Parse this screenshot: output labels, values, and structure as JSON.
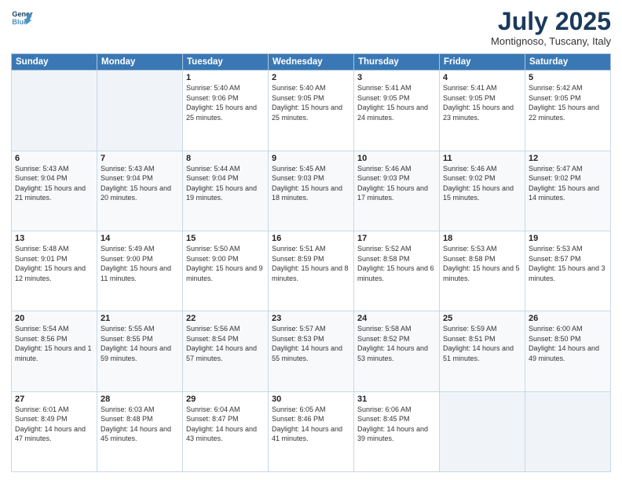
{
  "logo": {
    "line1": "General",
    "line2": "Blue"
  },
  "title": "July 2025",
  "subtitle": "Montignoso, Tuscany, Italy",
  "weekdays": [
    "Sunday",
    "Monday",
    "Tuesday",
    "Wednesday",
    "Thursday",
    "Friday",
    "Saturday"
  ],
  "weeks": [
    [
      {
        "day": "",
        "empty": true
      },
      {
        "day": "",
        "empty": true
      },
      {
        "day": "1",
        "sunrise": "5:40 AM",
        "sunset": "9:06 PM",
        "daylight": "15 hours and 25 minutes."
      },
      {
        "day": "2",
        "sunrise": "5:40 AM",
        "sunset": "9:05 PM",
        "daylight": "15 hours and 25 minutes."
      },
      {
        "day": "3",
        "sunrise": "5:41 AM",
        "sunset": "9:05 PM",
        "daylight": "15 hours and 24 minutes."
      },
      {
        "day": "4",
        "sunrise": "5:41 AM",
        "sunset": "9:05 PM",
        "daylight": "15 hours and 23 minutes."
      },
      {
        "day": "5",
        "sunrise": "5:42 AM",
        "sunset": "9:05 PM",
        "daylight": "15 hours and 22 minutes."
      }
    ],
    [
      {
        "day": "6",
        "sunrise": "5:43 AM",
        "sunset": "9:04 PM",
        "daylight": "15 hours and 21 minutes."
      },
      {
        "day": "7",
        "sunrise": "5:43 AM",
        "sunset": "9:04 PM",
        "daylight": "15 hours and 20 minutes."
      },
      {
        "day": "8",
        "sunrise": "5:44 AM",
        "sunset": "9:04 PM",
        "daylight": "15 hours and 19 minutes."
      },
      {
        "day": "9",
        "sunrise": "5:45 AM",
        "sunset": "9:03 PM",
        "daylight": "15 hours and 18 minutes."
      },
      {
        "day": "10",
        "sunrise": "5:46 AM",
        "sunset": "9:03 PM",
        "daylight": "15 hours and 17 minutes."
      },
      {
        "day": "11",
        "sunrise": "5:46 AM",
        "sunset": "9:02 PM",
        "daylight": "15 hours and 15 minutes."
      },
      {
        "day": "12",
        "sunrise": "5:47 AM",
        "sunset": "9:02 PM",
        "daylight": "15 hours and 14 minutes."
      }
    ],
    [
      {
        "day": "13",
        "sunrise": "5:48 AM",
        "sunset": "9:01 PM",
        "daylight": "15 hours and 12 minutes."
      },
      {
        "day": "14",
        "sunrise": "5:49 AM",
        "sunset": "9:00 PM",
        "daylight": "15 hours and 11 minutes."
      },
      {
        "day": "15",
        "sunrise": "5:50 AM",
        "sunset": "9:00 PM",
        "daylight": "15 hours and 9 minutes."
      },
      {
        "day": "16",
        "sunrise": "5:51 AM",
        "sunset": "8:59 PM",
        "daylight": "15 hours and 8 minutes."
      },
      {
        "day": "17",
        "sunrise": "5:52 AM",
        "sunset": "8:58 PM",
        "daylight": "15 hours and 6 minutes."
      },
      {
        "day": "18",
        "sunrise": "5:53 AM",
        "sunset": "8:58 PM",
        "daylight": "15 hours and 5 minutes."
      },
      {
        "day": "19",
        "sunrise": "5:53 AM",
        "sunset": "8:57 PM",
        "daylight": "15 hours and 3 minutes."
      }
    ],
    [
      {
        "day": "20",
        "sunrise": "5:54 AM",
        "sunset": "8:56 PM",
        "daylight": "15 hours and 1 minute."
      },
      {
        "day": "21",
        "sunrise": "5:55 AM",
        "sunset": "8:55 PM",
        "daylight": "14 hours and 59 minutes."
      },
      {
        "day": "22",
        "sunrise": "5:56 AM",
        "sunset": "8:54 PM",
        "daylight": "14 hours and 57 minutes."
      },
      {
        "day": "23",
        "sunrise": "5:57 AM",
        "sunset": "8:53 PM",
        "daylight": "14 hours and 55 minutes."
      },
      {
        "day": "24",
        "sunrise": "5:58 AM",
        "sunset": "8:52 PM",
        "daylight": "14 hours and 53 minutes."
      },
      {
        "day": "25",
        "sunrise": "5:59 AM",
        "sunset": "8:51 PM",
        "daylight": "14 hours and 51 minutes."
      },
      {
        "day": "26",
        "sunrise": "6:00 AM",
        "sunset": "8:50 PM",
        "daylight": "14 hours and 49 minutes."
      }
    ],
    [
      {
        "day": "27",
        "sunrise": "6:01 AM",
        "sunset": "8:49 PM",
        "daylight": "14 hours and 47 minutes."
      },
      {
        "day": "28",
        "sunrise": "6:03 AM",
        "sunset": "8:48 PM",
        "daylight": "14 hours and 45 minutes."
      },
      {
        "day": "29",
        "sunrise": "6:04 AM",
        "sunset": "8:47 PM",
        "daylight": "14 hours and 43 minutes."
      },
      {
        "day": "30",
        "sunrise": "6:05 AM",
        "sunset": "8:46 PM",
        "daylight": "14 hours and 41 minutes."
      },
      {
        "day": "31",
        "sunrise": "6:06 AM",
        "sunset": "8:45 PM",
        "daylight": "14 hours and 39 minutes."
      },
      {
        "day": "",
        "empty": true
      },
      {
        "day": "",
        "empty": true
      }
    ]
  ],
  "labels": {
    "sunrise": "Sunrise:",
    "sunset": "Sunset:",
    "daylight": "Daylight:"
  }
}
